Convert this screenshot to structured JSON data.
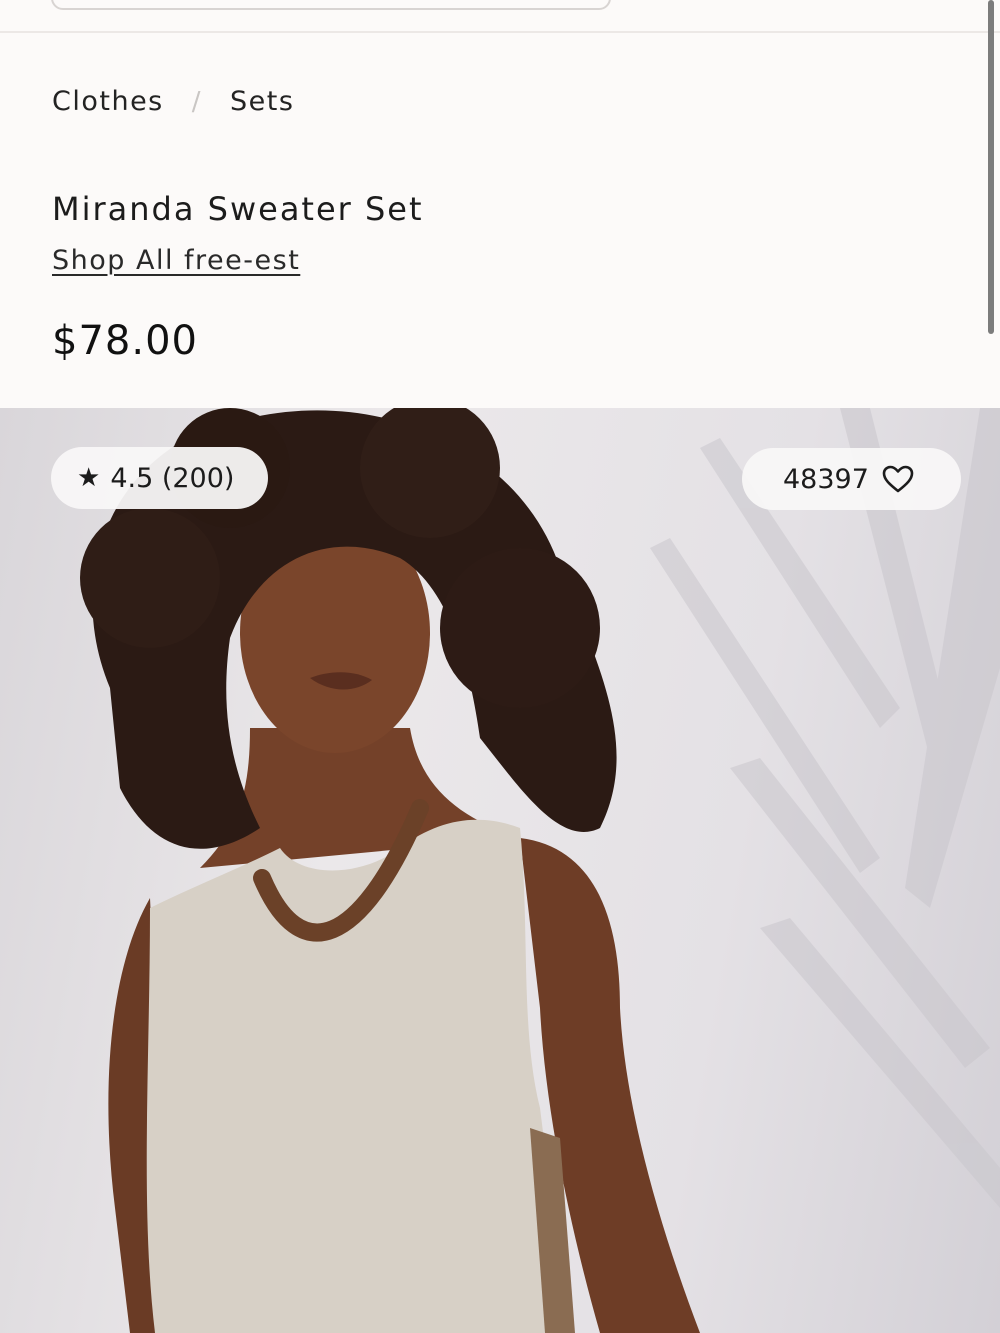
{
  "breadcrumb": {
    "items": [
      "Clothes",
      "Sets"
    ],
    "separator": "/"
  },
  "product": {
    "title": "Miranda Sweater Set",
    "brand_link": "Shop All free-est",
    "price": "$78.00"
  },
  "rating": {
    "star_icon": "★",
    "text": "4.5 (200)"
  },
  "favorites": {
    "count": "48397",
    "icon": "heart-outline"
  },
  "colors": {
    "background": "#fcfaf9",
    "text": "#1e1e1e",
    "pill_background": "#f8f7f7"
  }
}
